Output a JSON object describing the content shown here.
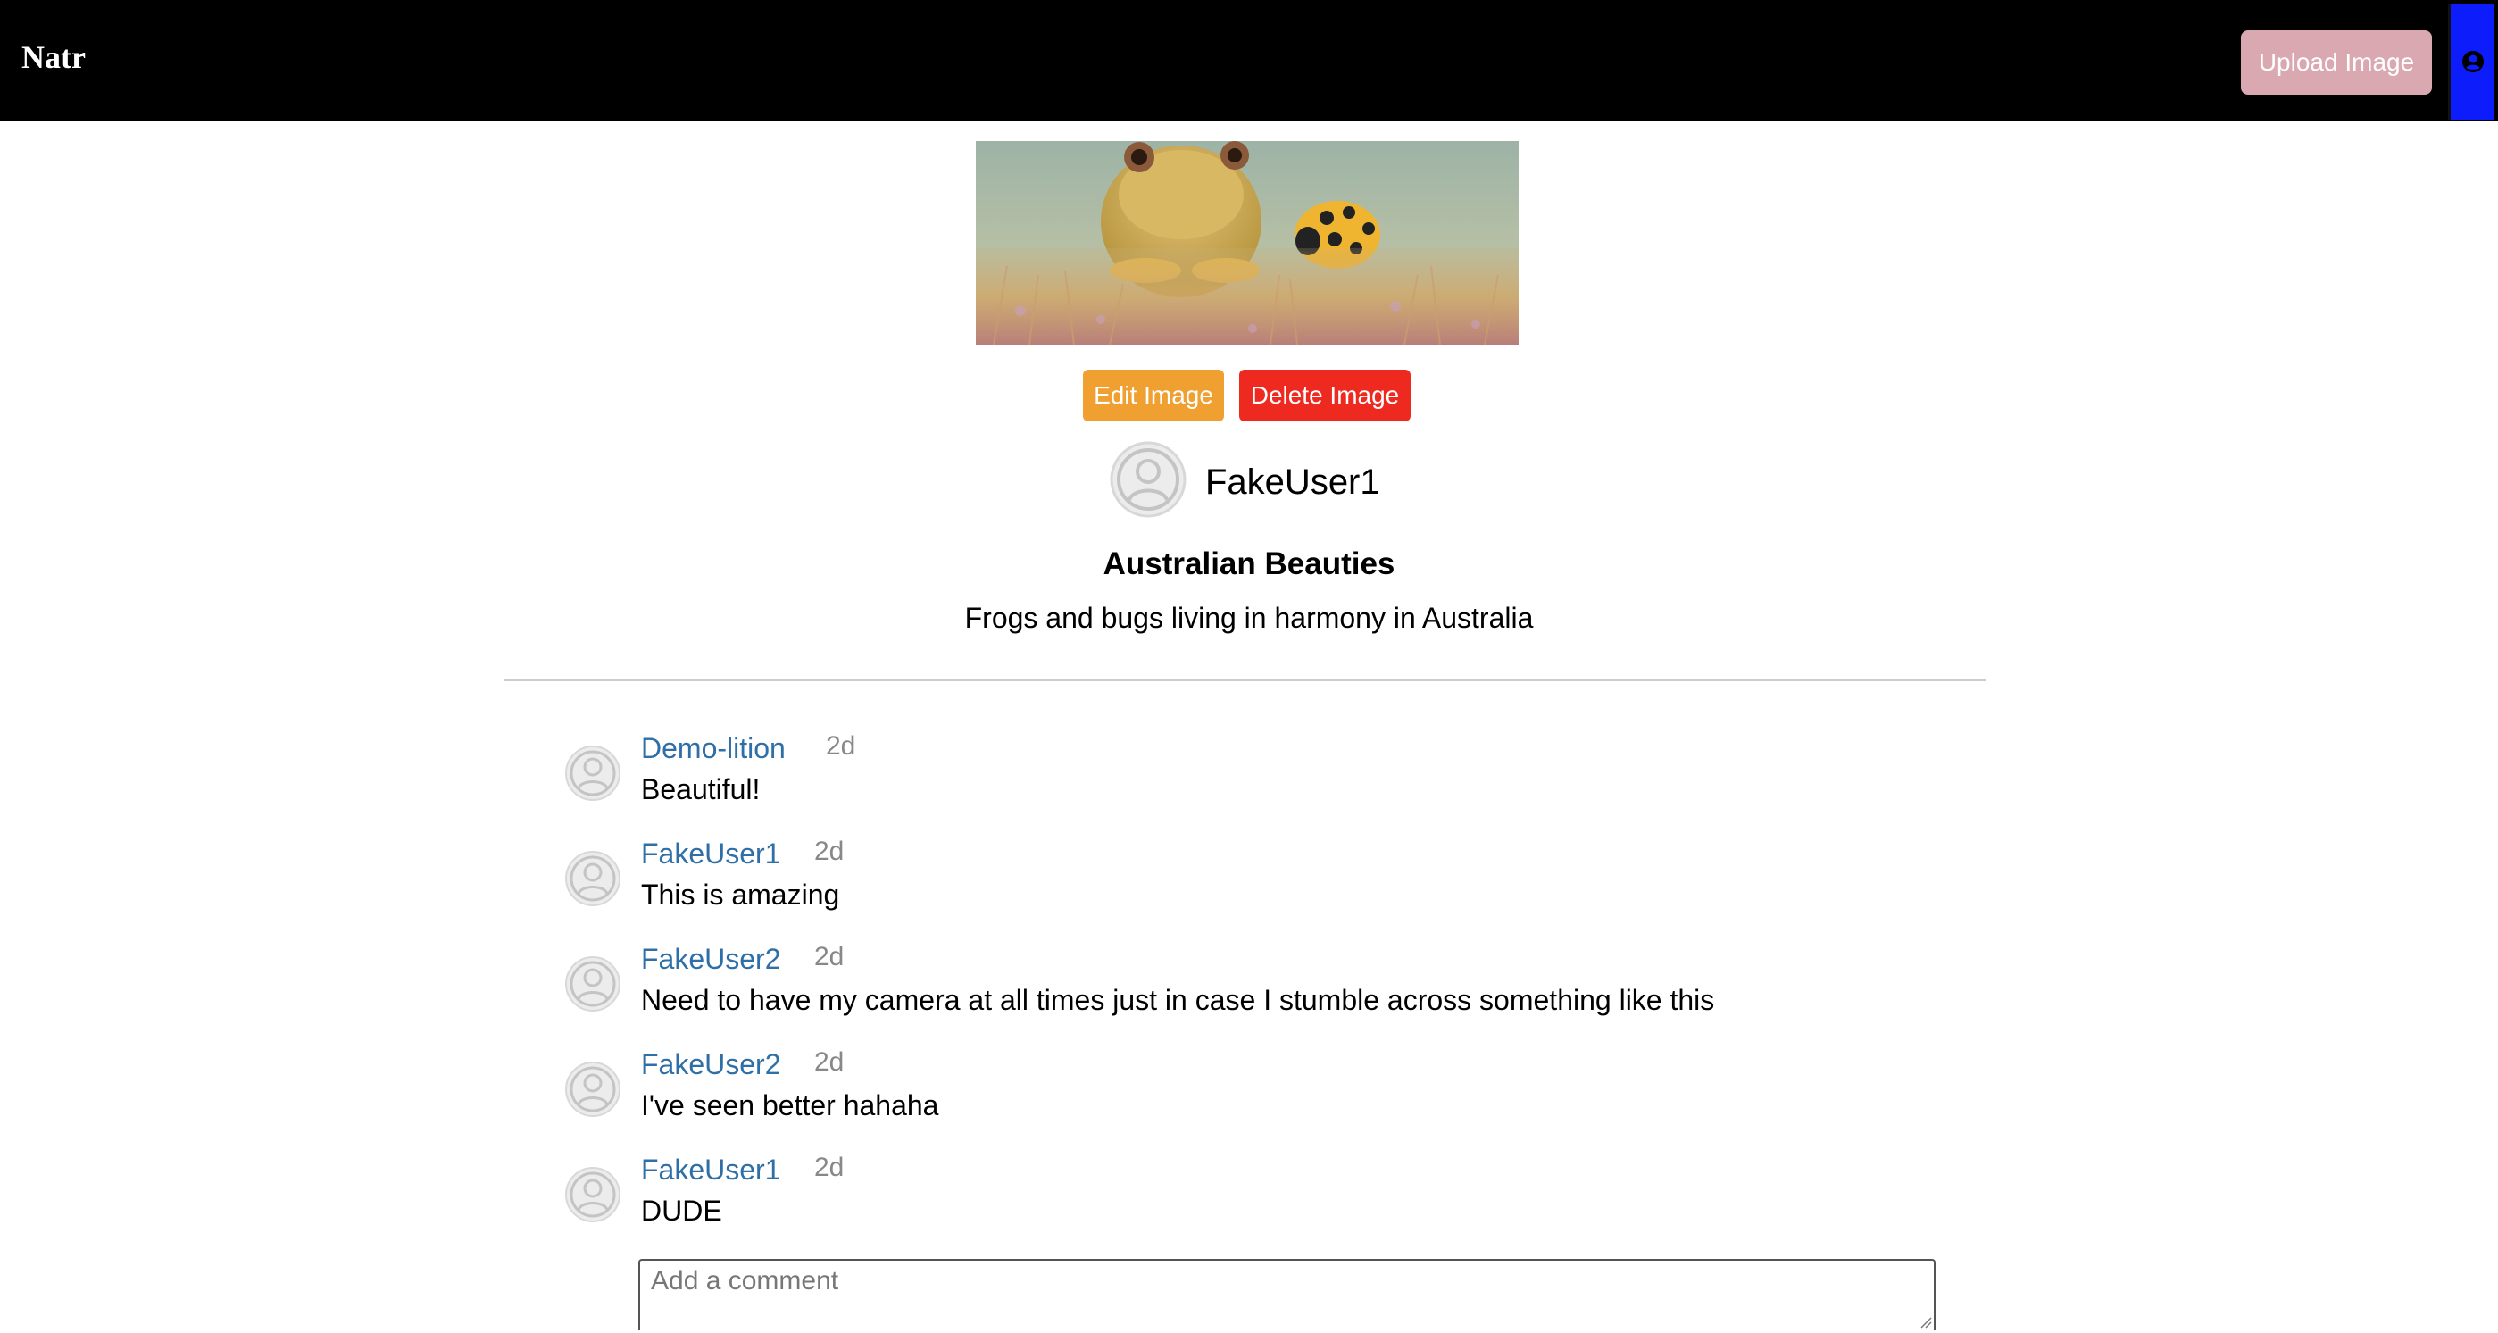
{
  "navbar": {
    "brand": "Natr",
    "upload_label": "Upload Image",
    "profile_icon": "user-circle-icon"
  },
  "post": {
    "owner": "FakeUser1",
    "title": "Australian Beauties",
    "description": "Frogs and bugs living in harmony in Australia",
    "edit_label": "Edit Image",
    "delete_label": "Delete Image",
    "image_subject": "frog-and-ladybug-photo"
  },
  "comments": [
    {
      "user": "Demo-lition",
      "time": "2d",
      "text": "Beautiful!"
    },
    {
      "user": "FakeUser1",
      "time": "2d",
      "text": "This is amazing"
    },
    {
      "user": "FakeUser2",
      "time": "2d",
      "text": "Need to have my camera at all times just in case I stumble across something like this"
    },
    {
      "user": "FakeUser2",
      "time": "2d",
      "text": "I've seen better hahaha"
    },
    {
      "user": "FakeUser1",
      "time": "2d",
      "text": "DUDE"
    }
  ],
  "comment_input": {
    "placeholder": "Add a comment",
    "value": ""
  },
  "colors": {
    "navbar_bg": "#000000",
    "upload_btn": "#d9a8b0",
    "profile_btn": "#0c1cfb",
    "edit_btn": "#f0a030",
    "delete_btn": "#ee2a20",
    "username_link": "#2f6fa7",
    "timestamp": "#888888"
  }
}
